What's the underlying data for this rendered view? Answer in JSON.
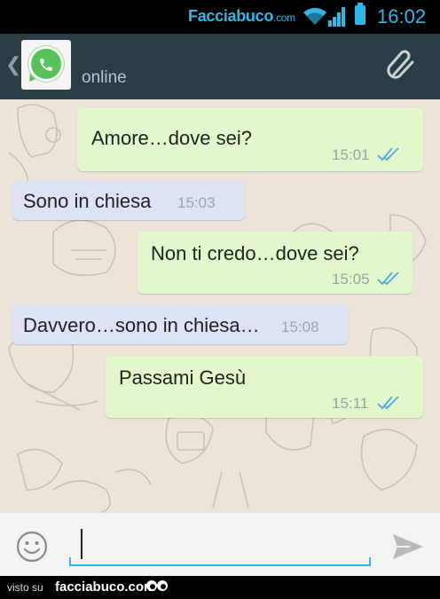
{
  "status_bar": {
    "brand": "Facciabuco",
    "brand_suffix": ".com",
    "time": "16:02",
    "accent_color": "#33b5e5",
    "icons": [
      "wifi-icon",
      "signal-icon",
      "battery-icon"
    ]
  },
  "header": {
    "back_icon": "chevron-left-icon",
    "avatar_icon": "whatsapp-logo-icon",
    "contact_status": "online",
    "attach_icon": "paperclip-icon",
    "background_color": "#2b3e46"
  },
  "messages": [
    {
      "direction": "outgoing",
      "text": "Amore…dove sei?",
      "time": "15:01",
      "status": "read"
    },
    {
      "direction": "incoming",
      "text": "Sono in chiesa",
      "time": "15:03"
    },
    {
      "direction": "outgoing",
      "text": "Non ti credo…dove sei?",
      "time": "15:05",
      "status": "read"
    },
    {
      "direction": "incoming",
      "text": "Davvero…sono in chiesa…",
      "time": "15:08"
    },
    {
      "direction": "outgoing",
      "text": "Passami Gesù",
      "time": "15:11",
      "status": "read"
    }
  ],
  "colors": {
    "outgoing_bubble": "#e2f7cb",
    "incoming_bubble": "#dde3f4",
    "read_ticks": "#4fa8e0",
    "chat_background": "#ece4d8"
  },
  "composer": {
    "emoji_icon": "smiley-icon",
    "value": "",
    "send_icon": "send-icon"
  },
  "footer": {
    "visto_label": "visto su",
    "site": "facciabuco.com",
    "eyes_icon": "eyes-icon"
  }
}
